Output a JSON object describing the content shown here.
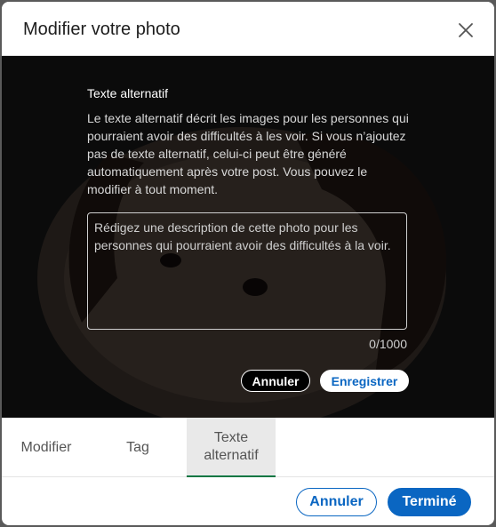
{
  "modal": {
    "title": "Modifier votre photo",
    "close_icon": "close-icon"
  },
  "alt_text_panel": {
    "title": "Texte alternatif",
    "description": "Le texte alternatif décrit les images pour les personnes qui pourraient avoir des difficultés à les voir. Si vous n’ajoutez pas de texte alternatif, celui-ci peut être généré automatiquement après votre post. Vous pouvez le modifier à tout moment.",
    "textarea_value": "",
    "textarea_placeholder": "Rédigez une description de cette photo pour les personnes qui pourraient avoir des difficultés à la voir.",
    "char_count": "0/1000",
    "cancel_label": "Annuler",
    "save_label": "Enregistrer"
  },
  "tabs": [
    {
      "label": "Modifier",
      "active": false
    },
    {
      "label": "Tag",
      "active": false
    },
    {
      "label": "Texte alternatif",
      "active": true
    }
  ],
  "footer": {
    "cancel_label": "Annuler",
    "done_label": "Terminé"
  },
  "colors": {
    "primary": "#0a66c2",
    "active_tab_underline": "#057642"
  }
}
